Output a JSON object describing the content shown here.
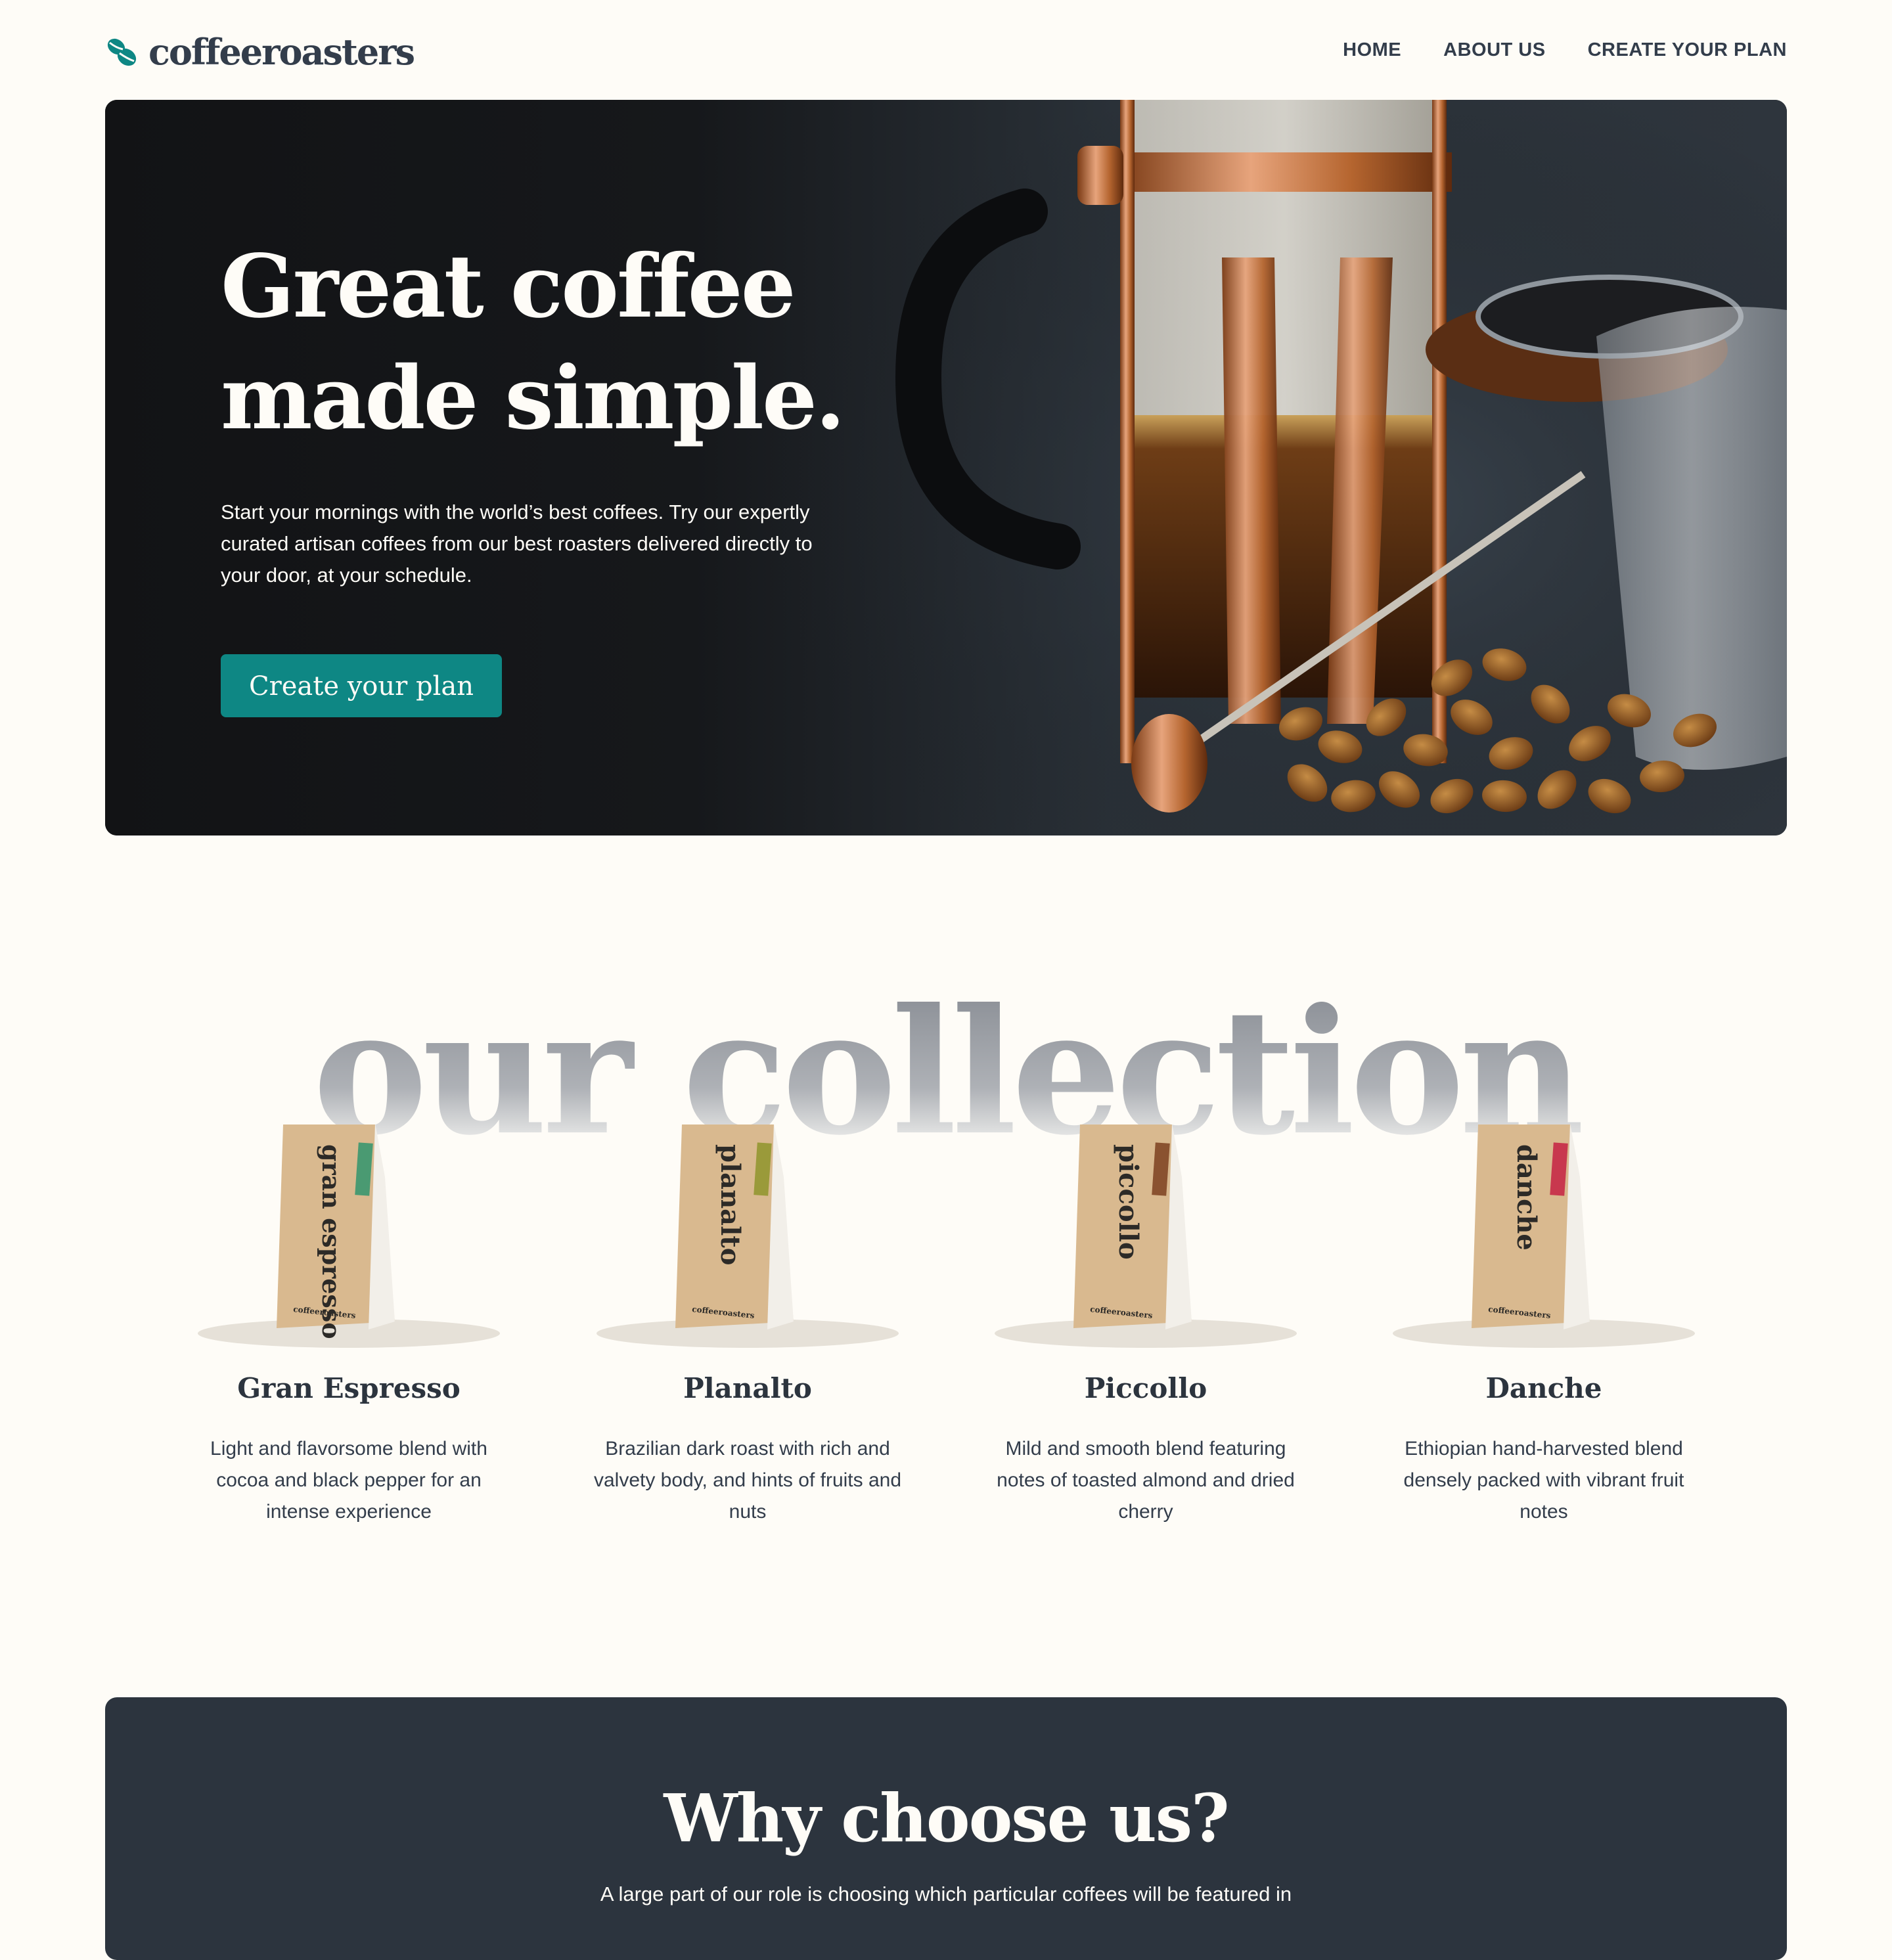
{
  "brand": {
    "name": "coffeeroasters",
    "logo_icon": "coffee-bean-icon",
    "accent_color": "#0e8784",
    "dark_color": "#333d4b"
  },
  "nav": {
    "items": [
      {
        "label": "HOME"
      },
      {
        "label": "ABOUT US"
      },
      {
        "label": "CREATE YOUR PLAN"
      }
    ]
  },
  "hero": {
    "title_line1": "Great coffee",
    "title_line2": "made simple.",
    "text": "Start your mornings with the world’s best coffees. Try our expertly curated artisan coffees from our best roasters delivered directly to your door, at your schedule.",
    "button_label": "Create your plan"
  },
  "collection": {
    "heading": "our collection",
    "products": [
      {
        "name": "Gran Espresso",
        "pack_label": "gran espresso",
        "stripe_color": "#4a9a72",
        "description": "Light and flavorsome blend with cocoa and black pepper for an intense experience"
      },
      {
        "name": "Planalto",
        "pack_label": "planalto",
        "stripe_color": "#9a9a3a",
        "description": "Brazilian dark roast with rich and valvety body, and hints of fruits and nuts"
      },
      {
        "name": "Piccollo",
        "pack_label": "piccollo",
        "stripe_color": "#8a5230",
        "description": "Mild and smooth blend featuring notes of toasted almond and dried cherry"
      },
      {
        "name": "Danche",
        "pack_label": "danche",
        "stripe_color": "#c8384e",
        "description": "Ethiopian hand-harvested blend densely packed with vibrant fruit notes"
      }
    ],
    "pack_brand": "coffeeroasters"
  },
  "why": {
    "title": "Why choose us?",
    "text": "A large part of our role is choosing which particular coffees will be featured in"
  }
}
